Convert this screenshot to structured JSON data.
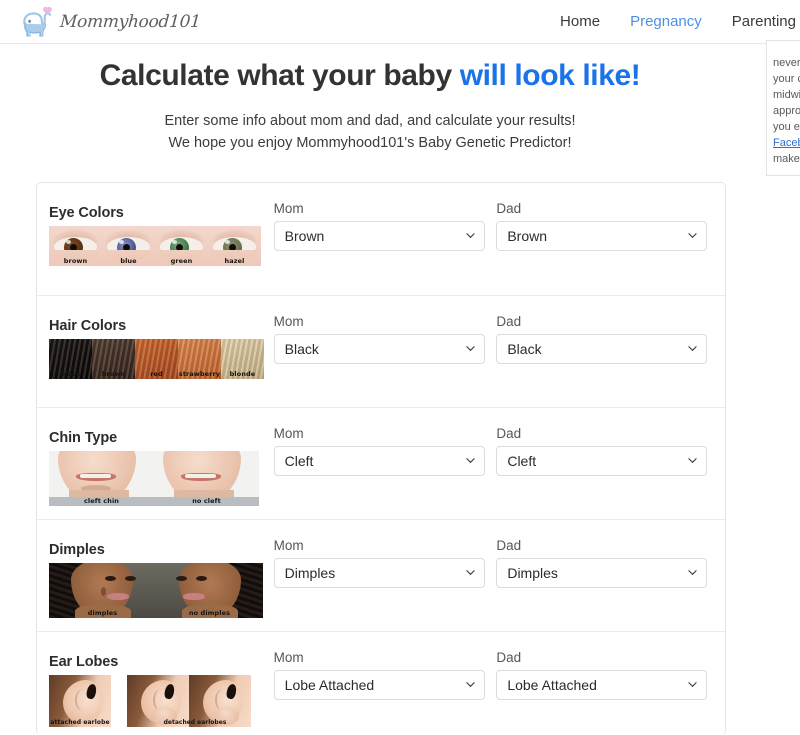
{
  "header": {
    "logo_text": "Mommyhood101",
    "logo_icon": "elephant-icon",
    "heart_icon": "heart-icon",
    "nav": [
      {
        "label": "Home",
        "active": false
      },
      {
        "label": "Pregnancy",
        "active": true
      },
      {
        "label": "Parenting",
        "active": false
      }
    ]
  },
  "hero": {
    "title_main": "Calculate what your baby ",
    "title_accent": "will look like!",
    "sub_line1": "Enter some info about mom and dad, and calculate your results!",
    "sub_line2": "We hope you enjoy Mommyhood101's Baby Genetic Predictor!"
  },
  "side_panel": {
    "lines": [
      "never",
      "your c",
      "midwi",
      "approp",
      "you ev"
    ],
    "link_text": "Facebo",
    "last_line": "make "
  },
  "form": {
    "mom_label": "Mom",
    "dad_label": "Dad",
    "chevron_icon": "chevron-down-icon",
    "rows": [
      {
        "title": "Eye Colors",
        "captions": [
          "brown",
          "blue",
          "green",
          "hazel"
        ],
        "mom_value": "Brown",
        "dad_value": "Brown"
      },
      {
        "title": "Hair Colors",
        "captions": [
          "black",
          "brown",
          "red",
          "strawberry",
          "blonde"
        ],
        "swatch_colors": [
          "#171210",
          "#46332a",
          "#c05c2b",
          "#d4773f",
          "#d9c59d"
        ],
        "mom_value": "Black",
        "dad_value": "Black"
      },
      {
        "title": "Chin Type",
        "captions": [
          "cleft chin",
          "no cleft"
        ],
        "mom_value": "Cleft",
        "dad_value": "Cleft"
      },
      {
        "title": "Dimples",
        "captions": [
          "dimples",
          "no dimples"
        ],
        "mom_value": "Dimples",
        "dad_value": "Dimples"
      },
      {
        "title": "Ear Lobes",
        "captions": [
          "attached earlobe",
          "detached earlobes"
        ],
        "mom_value": "Lobe Attached",
        "dad_value": "Lobe Attached"
      }
    ]
  },
  "colors": {
    "accent_blue": "#1a73e8",
    "nav_active": "#4a90e8",
    "text_dark": "#2d2d2d",
    "label_gray": "#555555",
    "border": "#e4e4e4"
  }
}
